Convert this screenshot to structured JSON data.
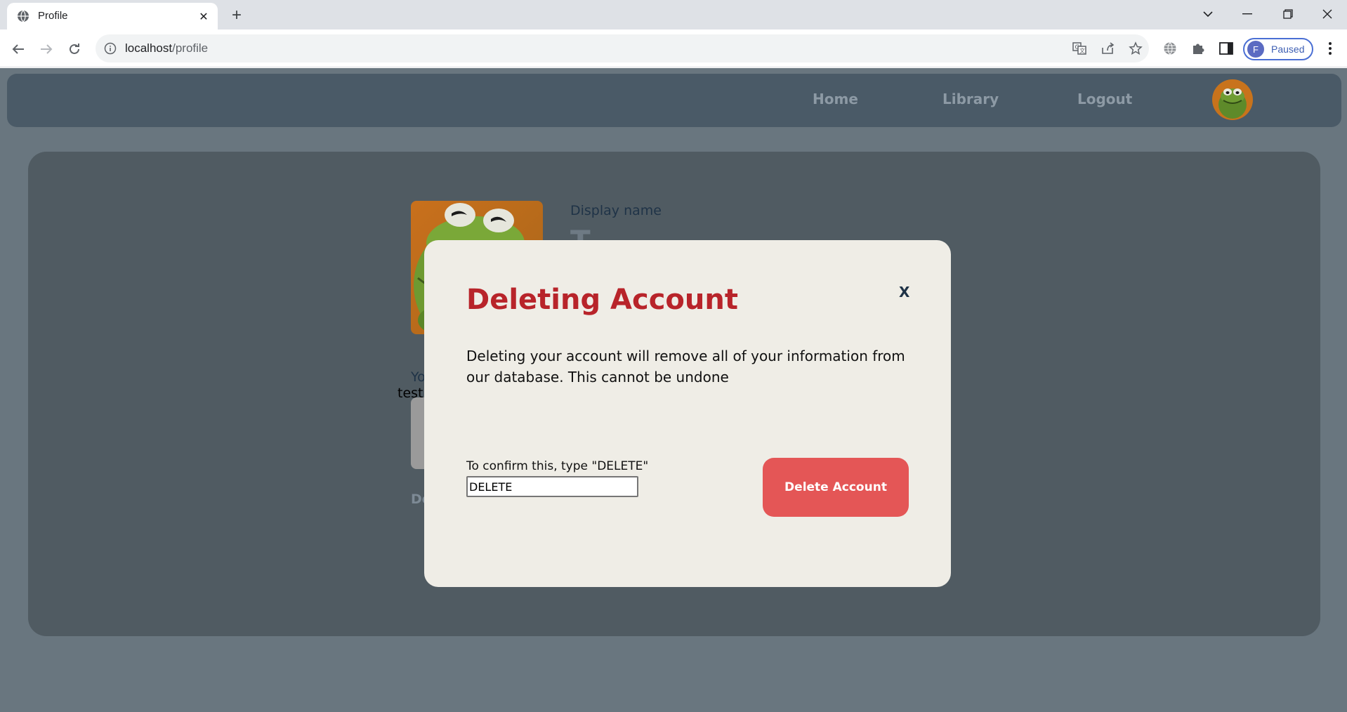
{
  "browser": {
    "tab_title": "Profile",
    "new_tab_label": "+",
    "url_host": "localhost",
    "url_path": "/profile",
    "profile_initial": "F",
    "profile_status": "Paused",
    "close_tab_glyph": "✕"
  },
  "navbar": {
    "links": [
      "Home",
      "Library",
      "Logout"
    ]
  },
  "profile": {
    "display_name_label": "Display name",
    "display_name_partial": "T",
    "bio_label_partial": "Yo",
    "bio_value_partial": "test",
    "danger_label_partial": "De"
  },
  "modal": {
    "title": "Deleting Account",
    "close_label": "X",
    "message": "Deleting your account will remove all of your information from our database. This cannot be undone",
    "confirm_label": "To confirm this, type \"DELETE\"",
    "confirm_value": "DELETE",
    "delete_button": "Delete Account"
  },
  "colors": {
    "modal_title": "#b8242a",
    "delete_button": "#e45656",
    "navbar": "#4a5a67",
    "page_bg": "#69767f",
    "panel_bg": "#505b62"
  }
}
